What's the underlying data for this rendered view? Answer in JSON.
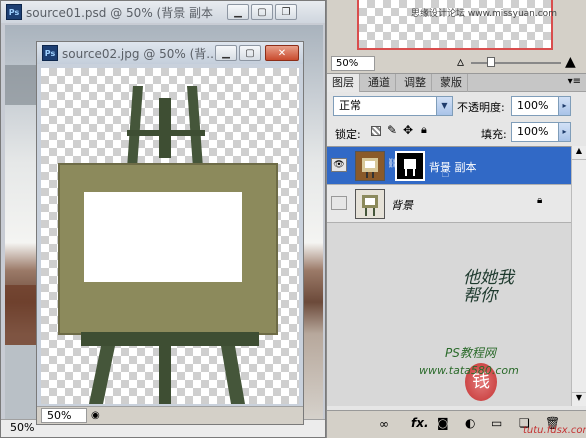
{
  "app": "Photoshop",
  "colors": {
    "selected_layer": "#3169c6",
    "titlebar": "#c9d3df",
    "close_button": "#c94b2e",
    "frame_olive": "#8c8a5c",
    "easel_dark": "#4a5a3a"
  },
  "window_back": {
    "icon_label": "Ps",
    "title": "source01.psd @ 50% (背景 副本",
    "zoom": "50%"
  },
  "window_front": {
    "icon_label": "Ps",
    "title": "source02.jpg @ 50% (背...",
    "zoom": "50%",
    "minimize_icon": "minimize-icon",
    "maximize_icon": "maximize-icon",
    "close_label": "✕"
  },
  "navigator": {
    "preview_text": "思缘设计论坛 www.missyuan.com",
    "zoom": "50%"
  },
  "layers_panel": {
    "tabs": [
      "图层",
      "通道",
      "调整",
      "蒙版"
    ],
    "blend_mode": "正常",
    "opacity_label": "不透明度:",
    "opacity_value": "100%",
    "lock_label": "锁定:",
    "fill_label": "填充:",
    "fill_value": "100%",
    "layers": [
      {
        "name": "背景 副本",
        "selected": true,
        "visible": true,
        "has_mask": true
      },
      {
        "name": "背景",
        "selected": false,
        "visible": false,
        "locked": true
      }
    ],
    "bottom_icons": [
      "link-icon",
      "fx-icon",
      "mask-icon",
      "adjustment-icon",
      "group-icon",
      "new-layer-icon",
      "trash-icon"
    ],
    "fx_label": "fx."
  },
  "watermark": {
    "text": "他她我帮你",
    "seal": "钱",
    "site_line1": "PS教程网",
    "site_line2": "www.tata580.com",
    "bottom": "tutu.fdsx.com"
  }
}
